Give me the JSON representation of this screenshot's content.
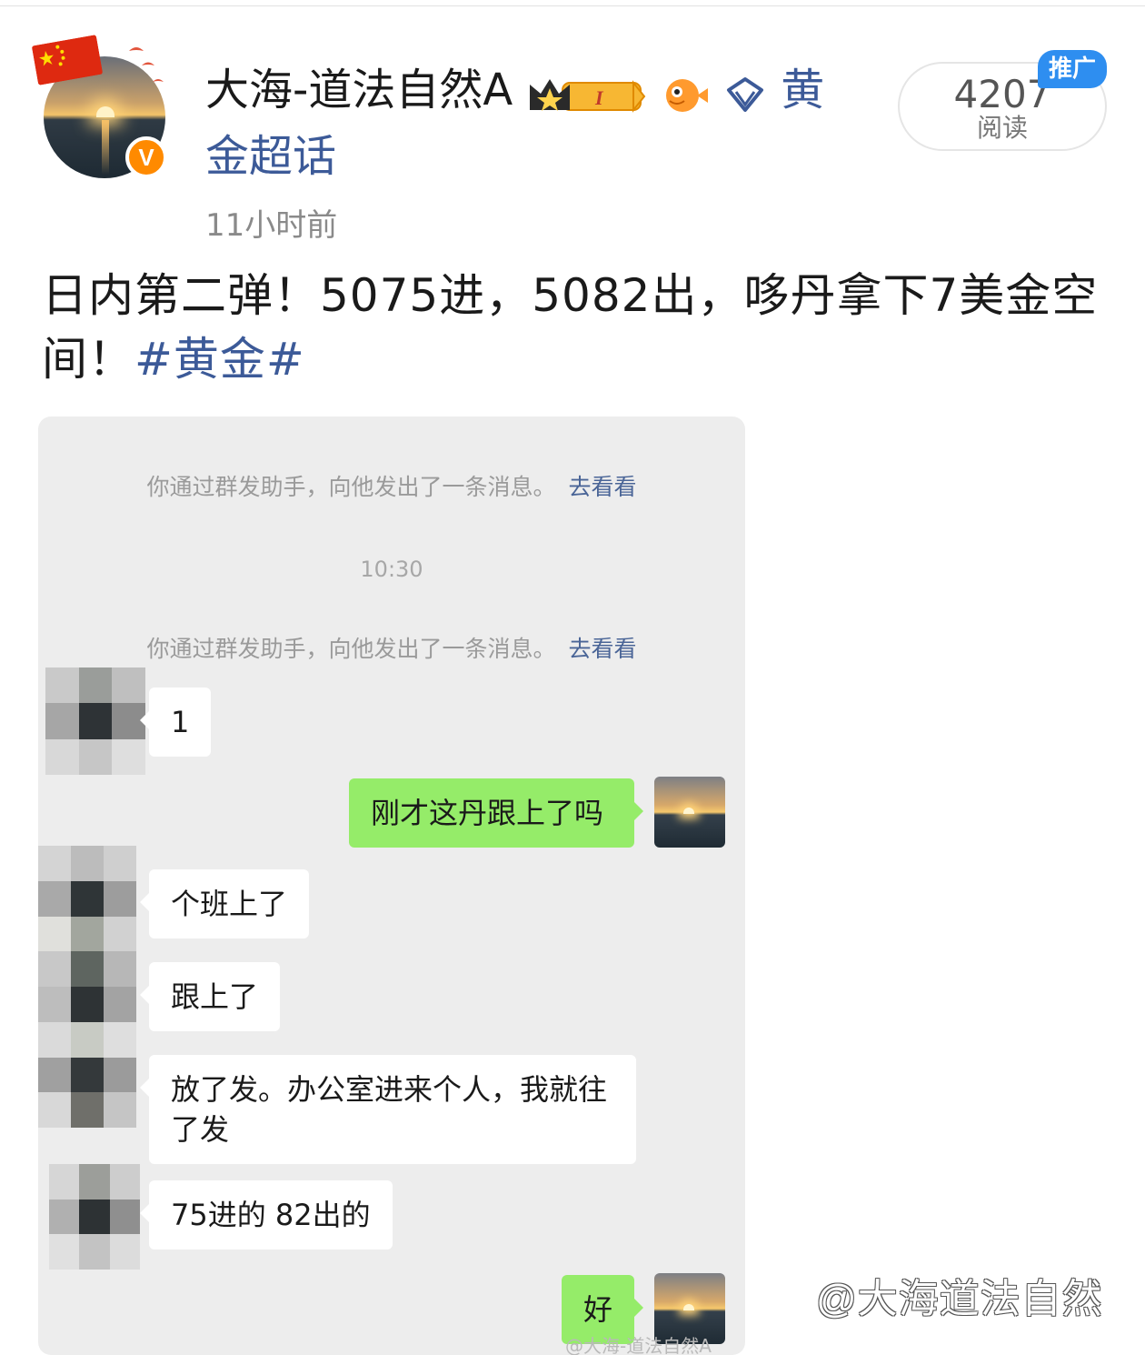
{
  "post": {
    "author": {
      "name": "大海-道法自然A",
      "verified_badge": "V",
      "badge_icons": [
        "crown-level-badge-icon",
        "pufferfish-icon",
        "diamond-icon"
      ],
      "supertopic_text": "黄金超话"
    },
    "time": "11小时前",
    "read_count": "4207",
    "read_label": "阅读",
    "promo_tag": "推广",
    "content_text": "日内第二弹！5075进，5082出，哆丹拿下7美金空间！",
    "hashtag": "#黄金#",
    "colors": {
      "link": "#3c5a98",
      "promo": "#2e8ef0",
      "verified": "#ff8a00",
      "my_bubble": "#95ec69"
    }
  },
  "chat": {
    "system_msg_1": "你通过群发助手，向他发出了一条消息。",
    "system_link_1": "去看看",
    "timestamp": "10:30",
    "system_msg_2": "你通过群发助手，向他发出了一条消息。",
    "system_link_2": "去看看",
    "msg_1": "1",
    "msg_2": "刚才这丹跟上了吗",
    "msg_3": "个班上了",
    "msg_4": "跟上了",
    "msg_5": "放了发。办公室进来个人，我就往了发",
    "msg_6": "75进的 82出的",
    "msg_7": "好",
    "image_watermark": "@大海-道法自然A"
  },
  "watermark": "@大海道法自然"
}
